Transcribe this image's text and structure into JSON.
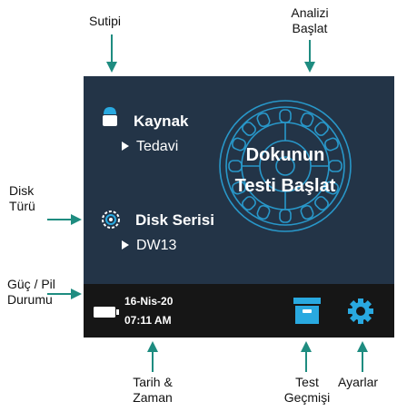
{
  "callouts": {
    "water_type": "Sutipi",
    "start_analysis_line1": "Analizi",
    "start_analysis_line2": "Başlat",
    "disk_type_line1": "Disk",
    "disk_type_line2": "Türü",
    "power_line1": "Güç / Pil",
    "power_line2": "Durumu",
    "datetime_line1": "Tarih &",
    "datetime_line2": "Zaman",
    "history_line1": "Test",
    "history_line2": "Geçmişi",
    "settings": "Ayarlar"
  },
  "screen": {
    "source_label": "Kaynak",
    "source_value": "Tedavi",
    "disk_label": "Disk Serisi",
    "disk_value": "DW13",
    "start_line1": "Dokunun",
    "start_line2": "Testi Başlat"
  },
  "status_bar": {
    "date": "16-Nis-20",
    "time": "07:11 AM"
  },
  "colors": {
    "screen_bg": "#233447",
    "status_bg": "#161616",
    "accent": "#29a9e0",
    "arrow": "#1e8c80"
  }
}
